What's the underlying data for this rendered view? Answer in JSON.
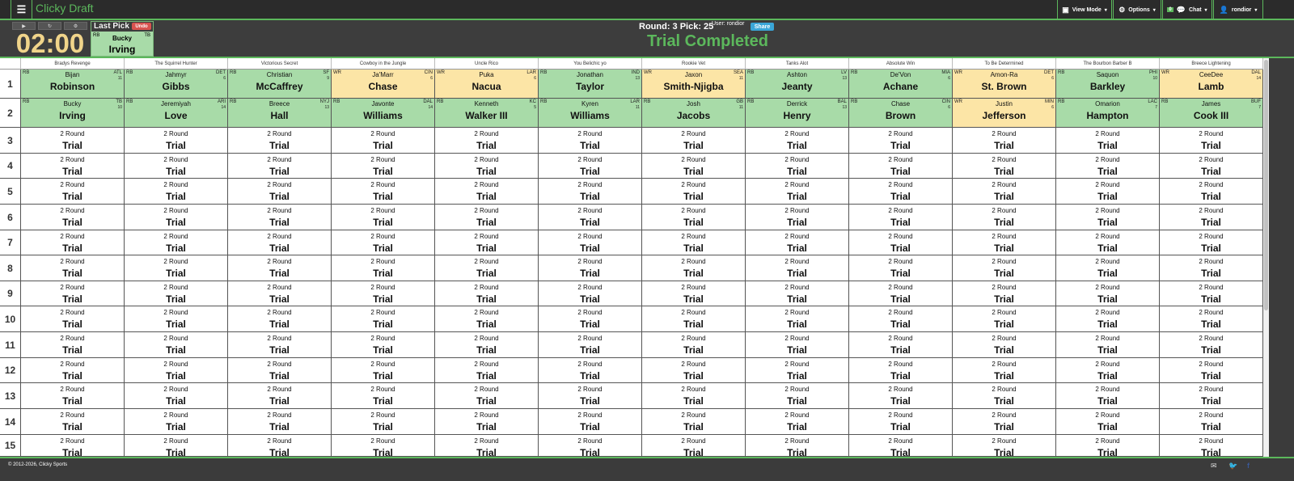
{
  "app": {
    "title": "Clicky Draft"
  },
  "navbar": {
    "view_mode": "View Mode",
    "options": "Options",
    "chat_badge": "0",
    "chat": "Chat",
    "user": "rondior"
  },
  "header": {
    "timer": "02:00",
    "last_pick_label": "Last Pick",
    "undo": "Undo",
    "last_pick": {
      "pos": "RB",
      "team": "TB",
      "first": "Bucky",
      "last": "Irving"
    },
    "round_info": "Round: 3 Pick: 25",
    "user_label": "User: rondior",
    "share": "Share",
    "status": "Trial Completed"
  },
  "colors": {
    "green": "#a8dba8",
    "yellow": "#fce5a6",
    "accent": "#5cb85c",
    "timer": "#f0d48a"
  },
  "teams": [
    "Bradys Revenge",
    "The Squirrel Hunter",
    "Victorious Secret",
    "Cowboy in the Jungle",
    "Uncle Rico",
    "You Belichic yo",
    "Rookie Vet",
    "Tanks Alot",
    "Absolute Win",
    "To Be Determined",
    "The Bourbon Barber B",
    "Breece Lightening"
  ],
  "picks": [
    [
      {
        "pos": "RB",
        "first": "Bijan",
        "last": "Robinson",
        "nfl": "ATL",
        "bye": "11",
        "color": "green"
      },
      {
        "pos": "RB",
        "first": "Jahmyr",
        "last": "Gibbs",
        "nfl": "DET",
        "bye": "6",
        "color": "green"
      },
      {
        "pos": "RB",
        "first": "Christian",
        "last": "McCaffrey",
        "nfl": "SF",
        "bye": "9",
        "color": "green"
      },
      {
        "pos": "WR",
        "first": "Ja'Marr",
        "last": "Chase",
        "nfl": "CIN",
        "bye": "6",
        "color": "yellow"
      },
      {
        "pos": "WR",
        "first": "Puka",
        "last": "Nacua",
        "nfl": "LAR",
        "bye": "6",
        "color": "yellow"
      },
      {
        "pos": "RB",
        "first": "Jonathan",
        "last": "Taylor",
        "nfl": "IND",
        "bye": "13",
        "color": "green"
      },
      {
        "pos": "WR",
        "first": "Jaxon",
        "last": "Smith-Njigba",
        "nfl": "SEA",
        "bye": "11",
        "color": "yellow"
      },
      {
        "pos": "RB",
        "first": "Ashton",
        "last": "Jeanty",
        "nfl": "LV",
        "bye": "13",
        "color": "green"
      },
      {
        "pos": "RB",
        "first": "De'Von",
        "last": "Achane",
        "nfl": "MIA",
        "bye": "6",
        "color": "green"
      },
      {
        "pos": "WR",
        "first": "Amon-Ra",
        "last": "St. Brown",
        "nfl": "DET",
        "bye": "6",
        "color": "yellow"
      },
      {
        "pos": "RB",
        "first": "Saquon",
        "last": "Barkley",
        "nfl": "PHI",
        "bye": "10",
        "color": "green"
      },
      {
        "pos": "WR",
        "first": "CeeDee",
        "last": "Lamb",
        "nfl": "DAL",
        "bye": "14",
        "color": "yellow"
      }
    ],
    [
      {
        "pos": "RB",
        "first": "Bucky",
        "last": "Irving",
        "nfl": "TB",
        "bye": "10",
        "color": "green"
      },
      {
        "pos": "RB",
        "first": "Jeremiyah",
        "last": "Love",
        "nfl": "ARI",
        "bye": "14",
        "color": "green"
      },
      {
        "pos": "RB",
        "first": "Breece",
        "last": "Hall",
        "nfl": "NYJ",
        "bye": "13",
        "color": "green"
      },
      {
        "pos": "RB",
        "first": "Javonte",
        "last": "Williams",
        "nfl": "DAL",
        "bye": "14",
        "color": "green"
      },
      {
        "pos": "RB",
        "first": "Kenneth",
        "last": "Walker III",
        "nfl": "KC",
        "bye": "5",
        "color": "green"
      },
      {
        "pos": "RB",
        "first": "Kyren",
        "last": "Williams",
        "nfl": "LAR",
        "bye": "11",
        "color": "green"
      },
      {
        "pos": "RB",
        "first": "Josh",
        "last": "Jacobs",
        "nfl": "GB",
        "bye": "11",
        "color": "green"
      },
      {
        "pos": "RB",
        "first": "Derrick",
        "last": "Henry",
        "nfl": "BAL",
        "bye": "13",
        "color": "green"
      },
      {
        "pos": "RB",
        "first": "Chase",
        "last": "Brown",
        "nfl": "CIN",
        "bye": "6",
        "color": "green"
      },
      {
        "pos": "WR",
        "first": "Justin",
        "last": "Jefferson",
        "nfl": "MIN",
        "bye": "6",
        "color": "yellow"
      },
      {
        "pos": "RB",
        "first": "Omarion",
        "last": "Hampton",
        "nfl": "LAC",
        "bye": "7",
        "color": "green"
      },
      {
        "pos": "RB",
        "first": "James",
        "last": "Cook III",
        "nfl": "BUF",
        "bye": "7",
        "color": "green"
      }
    ]
  ],
  "rounds": [
    "1",
    "2",
    "3",
    "4",
    "5",
    "6",
    "7",
    "8",
    "9",
    "10",
    "11",
    "12",
    "13",
    "14",
    "15"
  ],
  "empty_cell": {
    "top": "2 Round",
    "bottom": "Trial"
  },
  "footer": {
    "copyright": "© 2012-2026, Clicky Sports"
  }
}
